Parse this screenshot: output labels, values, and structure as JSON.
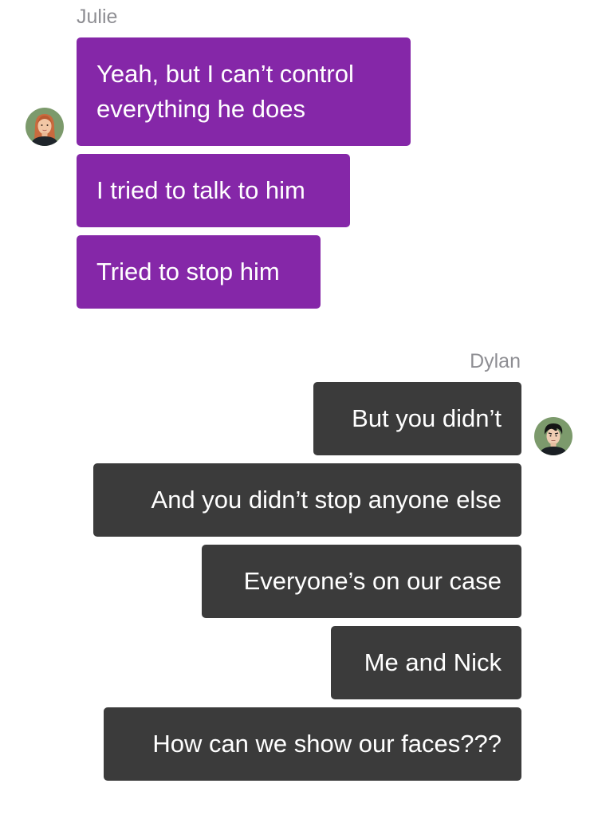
{
  "thread": {
    "groups": [
      {
        "sender": "Julie",
        "side": "left",
        "bubble_color": "#8527a8",
        "avatar_icon": "woman-avatar-icon",
        "messages": [
          "Yeah, but I can’t control everything he does",
          "I tried to talk to him",
          "Tried to stop him"
        ]
      },
      {
        "sender": "Dylan",
        "side": "right",
        "bubble_color": "#3b3b3b",
        "avatar_icon": "man-avatar-icon",
        "messages": [
          "But you didn’t",
          "And you didn’t stop anyone else",
          "Everyone’s on our case",
          "Me and Nick",
          "How can we show our faces???"
        ]
      }
    ]
  }
}
